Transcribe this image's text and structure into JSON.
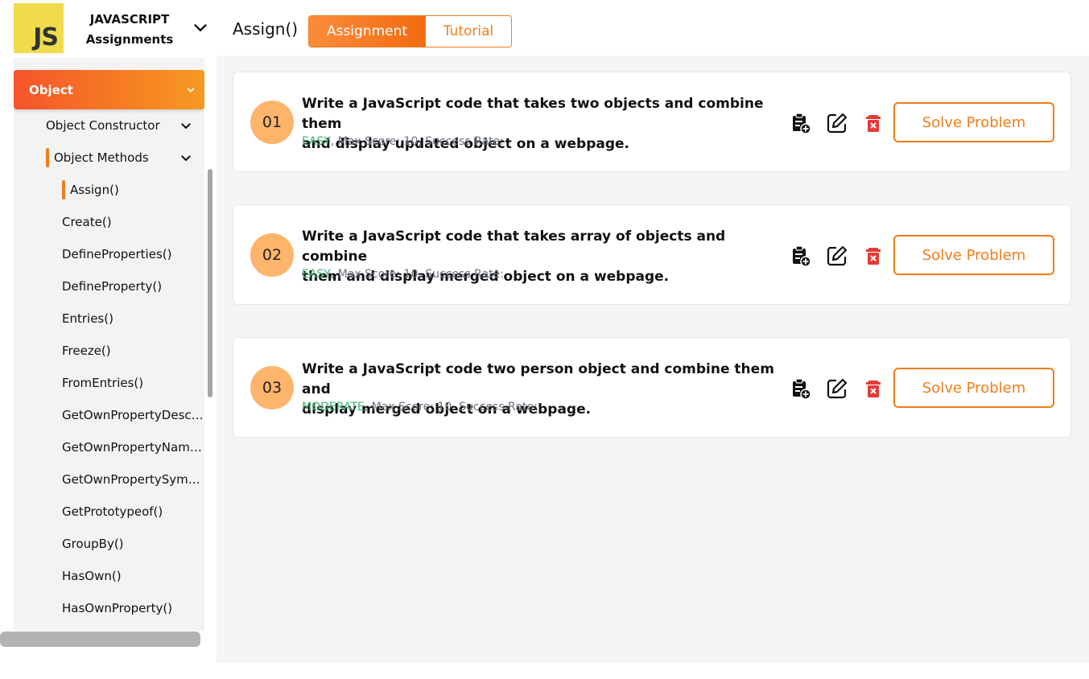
{
  "header": {
    "logo_text": "JS",
    "brand_line1": "JAVASCRIPT",
    "brand_line2": "Assignments",
    "page_title": "Assign()",
    "tabs": [
      {
        "label": "Assignment",
        "active": true
      },
      {
        "label": "Tutorial",
        "active": false
      }
    ]
  },
  "sidebar": {
    "category": "Object",
    "subsections": [
      {
        "label": "Object Constructor"
      },
      {
        "label": "Object Methods"
      }
    ],
    "items": [
      {
        "label": "Assign()",
        "active": true
      },
      {
        "label": "Create()"
      },
      {
        "label": "DefineProperties()"
      },
      {
        "label": "DefineProperty()"
      },
      {
        "label": "Entries()"
      },
      {
        "label": "Freeze()"
      },
      {
        "label": "FromEntries()"
      },
      {
        "label": "GetOwnPropertyDescri..."
      },
      {
        "label": "GetOwnPropertyNames("
      },
      {
        "label": "GetOwnPropertySymbol."
      },
      {
        "label": "GetPrototypeof()"
      },
      {
        "label": "GroupBy()"
      },
      {
        "label": "HasOwn()"
      },
      {
        "label": "HasOwnProperty()"
      }
    ]
  },
  "problems": [
    {
      "number": "01",
      "line1": "Write a JavaScript code that takes two objects and combine them",
      "line2": "and display updated object on a webpage.",
      "level": "EASY",
      "meta": ", Max Score: 10, Success Rate:",
      "button": "Solve Problem"
    },
    {
      "number": "02",
      "line1": "Write a JavaScript code that takes array of objects and combine",
      "line2": "them and display merged object on a webpage.",
      "level": "EASY",
      "meta": ", Max Score: 10, Success Rate:",
      "button": "Solve Problem"
    },
    {
      "number": "03",
      "line1": "Write a JavaScript code two person object and combine them and",
      "line2": "display merged object on a webpage.",
      "level": "MODERATE",
      "meta": ", Max Score: 10, Success Rate:",
      "button": "Solve Problem"
    }
  ],
  "colors": {
    "accent": "#f07c1a",
    "easy": "#3cb371",
    "delete": "#e53935",
    "number_circle": "#fdb46b"
  },
  "icons": [
    "chevron-down-icon",
    "clipboard-plus-icon",
    "edit-icon",
    "delete-icon"
  ]
}
